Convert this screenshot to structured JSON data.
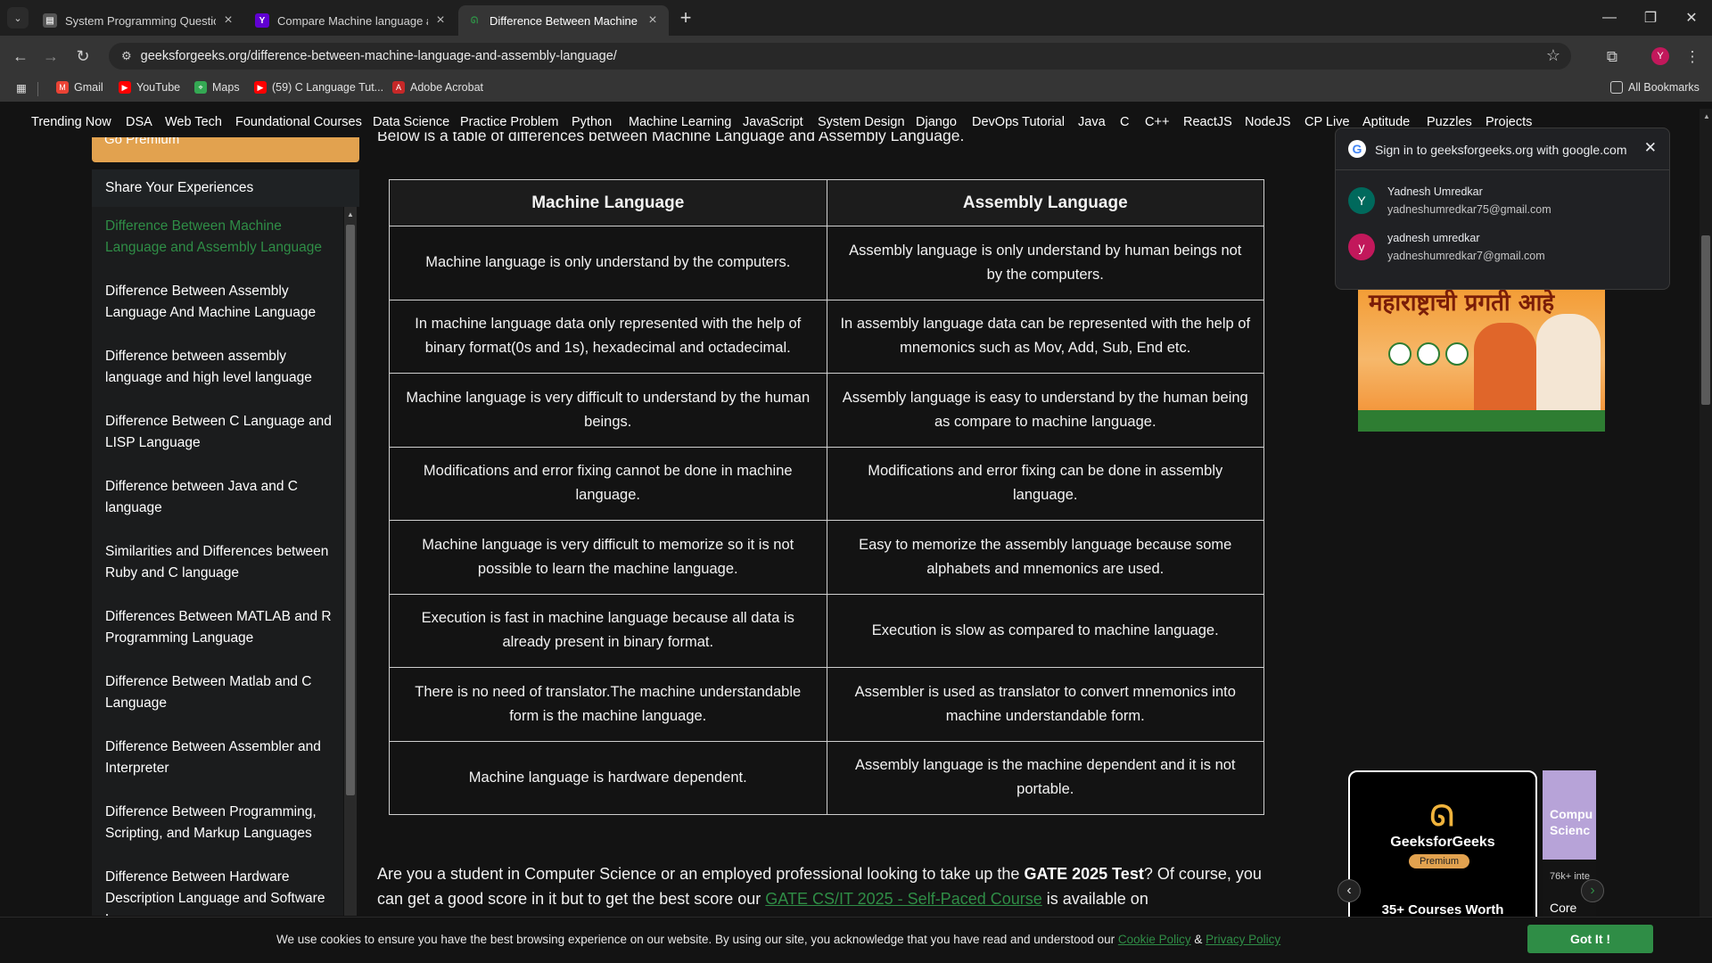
{
  "browser": {
    "tabs": [
      {
        "title": "System Programming Question",
        "favicon": "doc-icon"
      },
      {
        "title": "Compare Machine language an",
        "favicon": "yahoo-icon"
      },
      {
        "title": "Difference Between Machine La",
        "favicon": "gfg-icon"
      }
    ],
    "url": "geeksforgeeks.org/difference-between-machine-language-and-assembly-language/",
    "bookmarks": [
      "Gmail",
      "YouTube",
      "Maps",
      "(59) C Language Tut...",
      "Adobe Acrobat"
    ],
    "all_bookmarks": "All Bookmarks",
    "profile_initial": "Y"
  },
  "sitenav": [
    "Trending Now",
    "DSA",
    "Web Tech",
    "Foundational Courses",
    "Data Science",
    "Practice Problem",
    "Python",
    "Machine Learning",
    "JavaScript",
    "System Design",
    "Django",
    "DevOps Tutorial",
    "Java",
    "C",
    "C++",
    "ReactJS",
    "NodeJS",
    "CP Live",
    "Aptitude",
    "Puzzles",
    "Projects"
  ],
  "sidebar": {
    "premium": "Go Premium",
    "share": "Share Your Experiences",
    "items": [
      "Difference Between Machine Language and Assembly Language",
      "Difference Between Assembly Language And Machine Language",
      "Difference between assembly language and high level language",
      "Difference Between C Language and LISP Language",
      "Difference between Java and C language",
      "Similarities and Differences between Ruby and C language",
      "Differences Between MATLAB and R Programming Language",
      "Difference Between Matlab and C Language",
      "Difference Between Assembler and Interpreter",
      "Difference Between Programming, Scripting, and Markup Languages",
      "Difference Between Hardware Description Language and Software L..."
    ]
  },
  "article": {
    "intro": "Below is a table of differences between Machine Language and Assembly Language.",
    "headers": [
      "Machine Language",
      "Assembly Language"
    ],
    "rows": [
      [
        "Machine language is only understand by the computers.",
        "Assembly language is only understand by human beings not by the computers."
      ],
      [
        "In machine language data only represented with the help of binary format(0s and 1s), hexadecimal and octadecimal.",
        "In assembly language data can be represented with the help of mnemonics such as Mov, Add, Sub, End etc."
      ],
      [
        "Machine language is very difficult to understand by the human beings.",
        "Assembly language is easy to understand by the human being as compare to machine language."
      ],
      [
        "Modifications and error fixing cannot be done in machine language.",
        "Modifications and error fixing can be done in assembly language."
      ],
      [
        "Machine language is very difficult to memorize so it is not possible to learn the machine language.",
        "Easy to memorize the assembly language because some alphabets and mnemonics are used."
      ],
      [
        "Execution is fast in machine language because all data is already present in binary format.",
        "Execution is slow as compared to machine language."
      ],
      [
        "There is no need of translator.The machine understandable form is the machine language.",
        "Assembler is used as translator to convert mnemonics into machine understandable form."
      ],
      [
        "Machine language is hardware dependent.",
        "Assembly language is the machine dependent and it is not portable."
      ]
    ],
    "para_1": "Are you a student in Computer Science or an employed professional looking to take up the ",
    "para_bold": "GATE 2025 Test",
    "para_2": "? Of course, you can get a good score in it but to get the best score our ",
    "para_link": "GATE CS/IT 2025 - Self-Paced Course",
    "para_3": " is available on"
  },
  "google_popup": {
    "title": "Sign in to geeksforgeeks.org with google.com",
    "accounts": [
      {
        "initial": "Y",
        "name": "Yadnesh Umredkar",
        "email": "yadneshumredkar75@gmail.com",
        "color": "#00695c"
      },
      {
        "initial": "y",
        "name": "yadnesh umredkar",
        "email": "yadneshumredkar7@gmail.com",
        "color": "#c2185b"
      }
    ]
  },
  "ads": {
    "banner_text": "महाराष्ट्राची प्रगती आहे",
    "course_brand": "GeeksforGeeks",
    "course_premium": "Premium",
    "course_count": "35+ Courses Worth",
    "card2_title": "Compu Scienc",
    "card2_sub": "76k+ inte",
    "card2_bottom": "Core Co"
  },
  "cookie": {
    "message": "We use cookies to ensure you have the best browsing experience on our website. By using our site, you acknowledge that you have read and understood our ",
    "cookie_policy": "Cookie Policy",
    "amp": " & ",
    "privacy_policy": "Privacy Policy",
    "button": "Got It !"
  }
}
